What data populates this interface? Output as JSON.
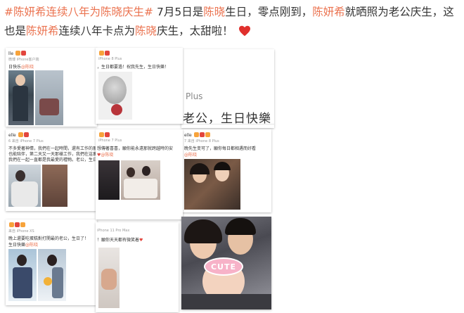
{
  "post": {
    "tag_open": "#",
    "tag_name_a": "陈妍希",
    "tag_mid": "连续八年为",
    "tag_name_b": "陈晓",
    "tag_end": "庆生#",
    "t1": " 7月5日是",
    "name_b1": "陈晓",
    "t2": "生日，零点刚到，",
    "name_a1": "陈妍希",
    "t3": "就晒照为老公庆生，这也是",
    "name_a2": "陈妍希",
    "t4": "连续八年卡点为",
    "name_b2": "陈晓",
    "t5": "庆生，太甜啦！",
    "heart_icon": "red-heart-icon",
    "accent_color": "#eb7350"
  },
  "cards": {
    "c1": {
      "user": "lle",
      "sub": "微博 iPhone客户端",
      "text": "日快乐",
      "link": "@陈晓"
    },
    "c2": {
      "sub": "iPhone 8 Plus",
      "text": "，生日都要過！祝我先生，生日快樂！"
    },
    "c3": {
      "big_sub": "Plus",
      "big_text": "老公，生日快樂"
    },
    "c4": {
      "user": "elle",
      "sub": "6 来自 iPhone 7 Plus",
      "text1": "不多愛著神情，我們在一起時間，還有工作的那段",
      "text2": "也能陪伴，第二天又一天那樣工作，我們在這裏的",
      "text3": "我們在一起一直都是我最愛的禮物。老公，生日"
    },
    "c5": {
      "sub": "iPhone 7 Plus",
      "text1": "想傳著喜喜，願你能永遠那就跨越時的安",
      "link": "@陈晓"
    },
    "c6": {
      "user": "elle",
      "sub": "7 来自 iPhone 8 Plus",
      "text1": "晚先生变可了，願你每日都相遇而好看",
      "link": "@陈晓"
    },
    "c7": {
      "sub": "来自 iPhone XS",
      "text1": "晚上還要吃蛋糕對打開最的老公，生日了！",
      "text2": "生日快樂",
      "link": "@陈晓"
    },
    "c8": {
      "sub": "iPhone 11 Pro Max",
      "text1": "！願你天天都有微笑着"
    },
    "c9": {
      "sticker": "CUTE"
    }
  }
}
